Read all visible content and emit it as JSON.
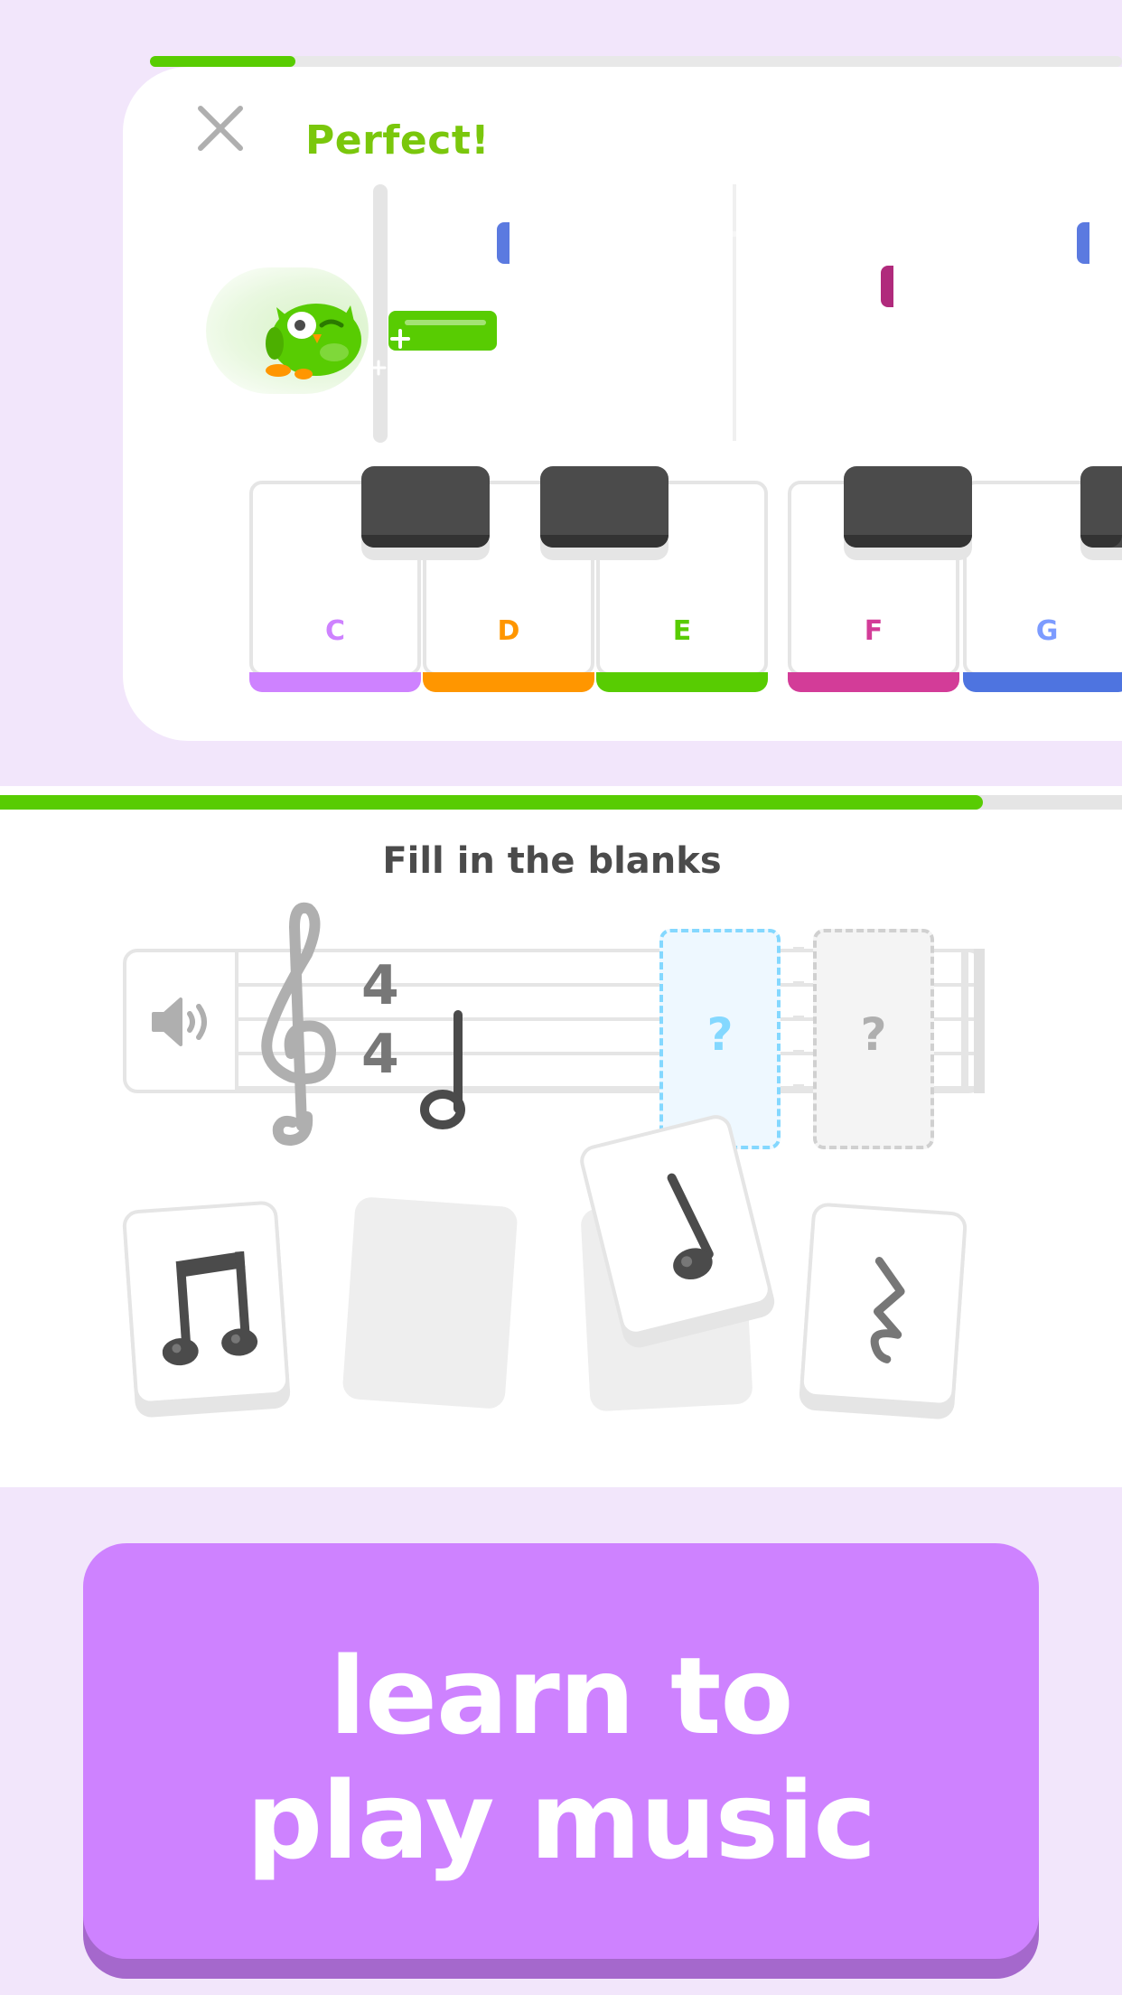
{
  "lesson": {
    "feedback": "Perfect!",
    "close_icon": "close-icon",
    "progress_fraction": 0.15,
    "notes": [
      {
        "label": "G",
        "color": "#7C9BFF"
      },
      {
        "label": "F",
        "color": "#D33C98"
      },
      {
        "label": "G",
        "color": "#7C9BFF"
      }
    ],
    "keys": [
      {
        "label": "C",
        "color": "#CE82FF"
      },
      {
        "label": "D",
        "color": "#FF9600"
      },
      {
        "label": "E",
        "color": "#58CC02"
      },
      {
        "label": "F",
        "color": "#D33C98"
      },
      {
        "label": "G",
        "color": "#4E74E0"
      }
    ]
  },
  "exercise": {
    "progress_fraction": 0.876,
    "title": "Fill in the blanks",
    "time_signature": {
      "top": "4",
      "bottom": "4"
    },
    "blanks": [
      "?",
      "?"
    ],
    "cards": [
      {
        "icon": "beamed-eighth-notes-icon"
      },
      {
        "icon": "empty-card"
      },
      {
        "icon": "quarter-note-icon"
      },
      {
        "icon": "quarter-rest-icon"
      }
    ]
  },
  "cta": {
    "line1": "learn to",
    "line2": "play music",
    "color": "#CE82FF"
  }
}
